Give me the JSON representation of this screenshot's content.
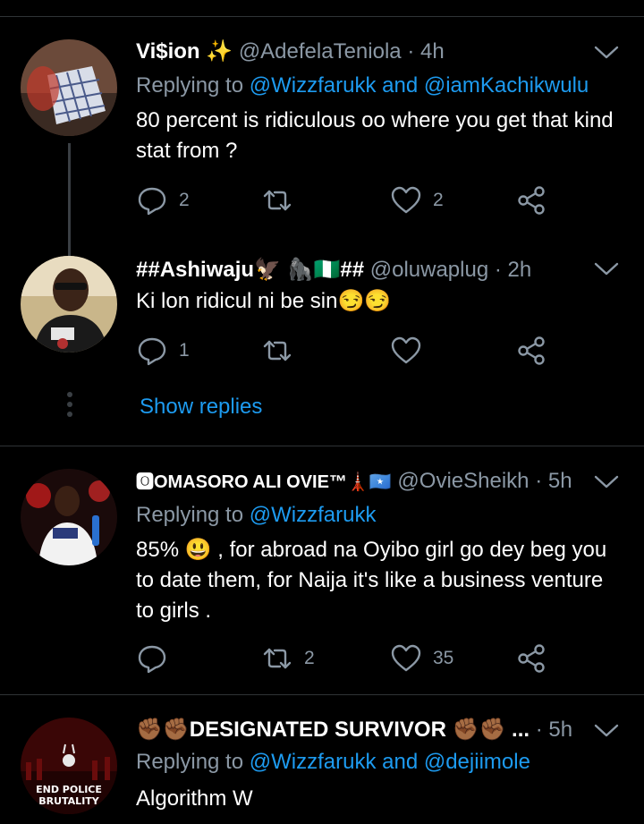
{
  "tweets": [
    {
      "name": "Vi$ion ✨",
      "handle": "@AdefelaTeniola",
      "sep": "·",
      "time": "4h",
      "replying_prefix": "Replying to ",
      "replying_users": [
        "@Wizzfarukk",
        "@iamKachikwulu"
      ],
      "replying_and": " and ",
      "text": "80 percent is ridiculous oo where you get that kind stat from ?",
      "replies": "2",
      "retweets": "",
      "likes": "2"
    },
    {
      "name": "##Ashiwaju🦅 🦍🇳🇬##",
      "handle": "@oluwaplug",
      "sep": "·",
      "time": "2h",
      "text": "Ki lon ridicul ni be sin😏😏",
      "replies": "1",
      "retweets": "",
      "likes": ""
    },
    {
      "name": "🅾OMASORO ALI OVIE™🗼🇸🇴",
      "handle": "@OvieSheikh",
      "sep": "·",
      "time": "5h",
      "replying_prefix": "Replying to ",
      "replying_users": [
        "@Wizzfarukk"
      ],
      "text": "85% 😃 , for abroad na Oyibo girl go dey beg you to date them, for Naija it's like a business venture to girls .",
      "replies": "",
      "retweets": "2",
      "likes": "35"
    },
    {
      "name": "✊🏾✊🏾DESIGNATED SURVIVOR ✊🏾✊🏾 ...",
      "handle": "",
      "sep": "·",
      "time": "5h",
      "replying_prefix": "Replying to ",
      "replying_users": [
        "@Wizzfarukk",
        "@dejiimole"
      ],
      "replying_and": " and ",
      "text": "Algorithm W",
      "avatar_text": "END POLICE BRUTALITY"
    }
  ],
  "show_replies": "Show replies",
  "colors": {
    "background": "#000000",
    "link": "#1d9bf0",
    "muted": "#8b98a5",
    "divider": "#2f3336"
  }
}
